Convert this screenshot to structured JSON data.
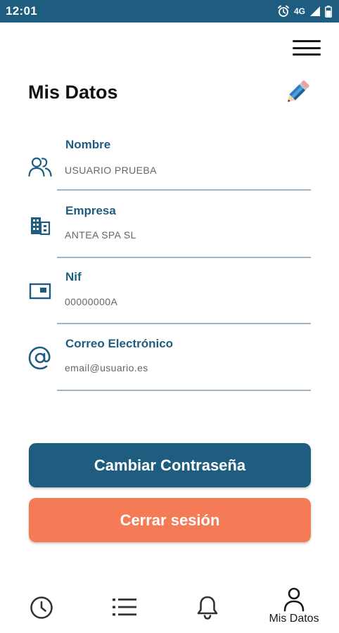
{
  "status_bar": {
    "time": "12:01",
    "network": "4G",
    "icons": [
      "alarm-icon",
      "signal-icon",
      "battery-icon"
    ]
  },
  "header": {
    "title": "Mis Datos",
    "menu_icon": "hamburger-menu-icon",
    "edit_icon": "pencil-icon"
  },
  "fields": [
    {
      "icon": "users-icon",
      "label": "Nombre",
      "value": "USUARIO PRUEBA"
    },
    {
      "icon": "building-icon",
      "label": "Empresa",
      "value": "ANTEA SPA SL"
    },
    {
      "icon": "id-card-icon",
      "label": "Nif",
      "value": "00000000A"
    },
    {
      "icon": "at-sign-icon",
      "label": "Correo Electrónico",
      "value": "email@usuario.es"
    }
  ],
  "actions": {
    "change_password": "Cambiar Contraseña",
    "logout": "Cerrar sesión"
  },
  "bottom_nav": {
    "items": [
      {
        "icon": "clock-icon"
      },
      {
        "icon": "list-icon"
      },
      {
        "icon": "bell-icon"
      },
      {
        "icon": "user-icon",
        "label": "Mis Datos"
      }
    ]
  },
  "colors": {
    "primary": "#1f5d80",
    "accent": "#f57b56",
    "label": "#1f5d80",
    "value": "#666666",
    "divider": "#9fb3c3"
  }
}
